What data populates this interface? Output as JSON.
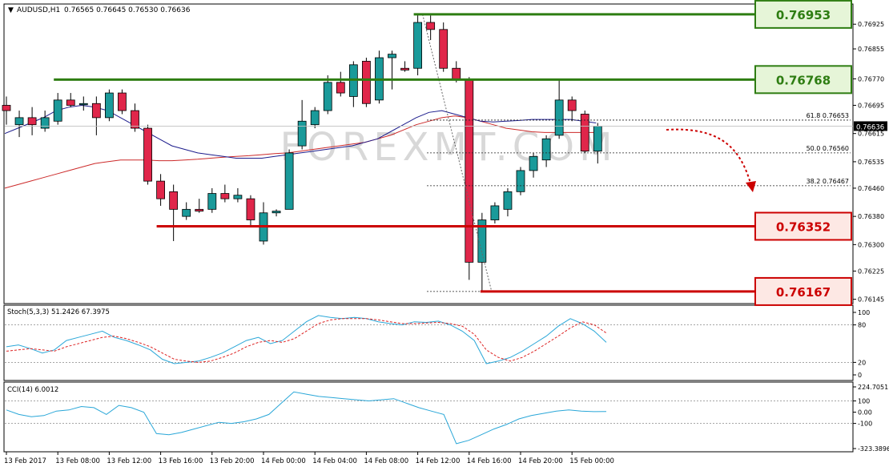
{
  "header": {
    "menu_arrow": "▼",
    "symbol": "AUDUSD,H1",
    "ohlc": "0.76565 0.76645 0.76530 0.76636"
  },
  "watermark": "FOREXMT.COM",
  "chart_data": [
    {
      "type": "candlestick",
      "panel": "price",
      "y_ticks": [
        "0.76925",
        "0.76855",
        "0.76770",
        "0.76695",
        "0.76615",
        "0.76535",
        "0.76460",
        "0.76380",
        "0.76300",
        "0.76225",
        "0.76145"
      ],
      "y_tick_values": [
        0.76925,
        0.76855,
        0.7677,
        0.76695,
        0.76615,
        0.76535,
        0.7646,
        0.7638,
        0.763,
        0.76225,
        0.76145
      ],
      "ylim": [
        0.76135,
        0.7698
      ],
      "current_price_label": "0.76636",
      "current_price": 0.76636,
      "colors": {
        "bull": "#1a9a9a",
        "bear": "#e0264a",
        "ma_blue": "#1c1c8c",
        "ma_red": "#cc2a2a",
        "level_green": "#2e7d12",
        "level_red": "#cc0000"
      },
      "candles": [
        {
          "o": 0.76695,
          "h": 0.7672,
          "l": 0.7664,
          "c": 0.7668
        },
        {
          "o": 0.7664,
          "h": 0.7668,
          "l": 0.76605,
          "c": 0.7666
        },
        {
          "o": 0.7666,
          "h": 0.7669,
          "l": 0.7661,
          "c": 0.7664
        },
        {
          "o": 0.7663,
          "h": 0.7668,
          "l": 0.7662,
          "c": 0.7666
        },
        {
          "o": 0.7665,
          "h": 0.7673,
          "l": 0.7664,
          "c": 0.7671
        },
        {
          "o": 0.7671,
          "h": 0.7673,
          "l": 0.7669,
          "c": 0.76695
        },
        {
          "o": 0.767,
          "h": 0.7672,
          "l": 0.7668,
          "c": 0.767
        },
        {
          "o": 0.767,
          "h": 0.7672,
          "l": 0.7661,
          "c": 0.7666
        },
        {
          "o": 0.7666,
          "h": 0.7674,
          "l": 0.7665,
          "c": 0.7673
        },
        {
          "o": 0.7673,
          "h": 0.7674,
          "l": 0.7667,
          "c": 0.7668
        },
        {
          "o": 0.7668,
          "h": 0.767,
          "l": 0.7662,
          "c": 0.7663
        },
        {
          "o": 0.7663,
          "h": 0.7664,
          "l": 0.7647,
          "c": 0.7648
        },
        {
          "o": 0.7648,
          "h": 0.765,
          "l": 0.7641,
          "c": 0.7643
        },
        {
          "o": 0.7645,
          "h": 0.7647,
          "l": 0.7631,
          "c": 0.764
        },
        {
          "o": 0.7638,
          "h": 0.7642,
          "l": 0.7637,
          "c": 0.764
        },
        {
          "o": 0.764,
          "h": 0.7643,
          "l": 0.7639,
          "c": 0.76395
        },
        {
          "o": 0.764,
          "h": 0.7646,
          "l": 0.7639,
          "c": 0.76445
        },
        {
          "o": 0.76445,
          "h": 0.7647,
          "l": 0.7642,
          "c": 0.7643
        },
        {
          "o": 0.7643,
          "h": 0.7646,
          "l": 0.7642,
          "c": 0.7644
        },
        {
          "o": 0.7643,
          "h": 0.7644,
          "l": 0.7635,
          "c": 0.7637
        },
        {
          "o": 0.7631,
          "h": 0.7642,
          "l": 0.763,
          "c": 0.7639
        },
        {
          "o": 0.7639,
          "h": 0.764,
          "l": 0.7638,
          "c": 0.76395
        },
        {
          "o": 0.764,
          "h": 0.7657,
          "l": 0.764,
          "c": 0.7656
        },
        {
          "o": 0.7658,
          "h": 0.7671,
          "l": 0.7657,
          "c": 0.7665
        },
        {
          "o": 0.7664,
          "h": 0.7669,
          "l": 0.7663,
          "c": 0.7668
        },
        {
          "o": 0.7668,
          "h": 0.7678,
          "l": 0.7667,
          "c": 0.7676
        },
        {
          "o": 0.7676,
          "h": 0.7679,
          "l": 0.7672,
          "c": 0.7673
        },
        {
          "o": 0.7672,
          "h": 0.7682,
          "l": 0.7669,
          "c": 0.7681
        },
        {
          "o": 0.7682,
          "h": 0.7683,
          "l": 0.7669,
          "c": 0.767
        },
        {
          "o": 0.7671,
          "h": 0.7685,
          "l": 0.767,
          "c": 0.7683
        },
        {
          "o": 0.7683,
          "h": 0.7685,
          "l": 0.7674,
          "c": 0.7684
        },
        {
          "o": 0.768,
          "h": 0.7682,
          "l": 0.7679,
          "c": 0.76795
        },
        {
          "o": 0.768,
          "h": 0.76953,
          "l": 0.7678,
          "c": 0.7693
        },
        {
          "o": 0.7693,
          "h": 0.7695,
          "l": 0.7688,
          "c": 0.7691
        },
        {
          "o": 0.7691,
          "h": 0.7693,
          "l": 0.7679,
          "c": 0.768
        },
        {
          "o": 0.768,
          "h": 0.7682,
          "l": 0.7676,
          "c": 0.7677
        },
        {
          "o": 0.7677,
          "h": 0.76775,
          "l": 0.762,
          "c": 0.7625
        },
        {
          "o": 0.7625,
          "h": 0.7639,
          "l": 0.76167,
          "c": 0.7637
        },
        {
          "o": 0.7637,
          "h": 0.7642,
          "l": 0.7636,
          "c": 0.7641
        },
        {
          "o": 0.764,
          "h": 0.7646,
          "l": 0.7638,
          "c": 0.7645
        },
        {
          "o": 0.7645,
          "h": 0.7652,
          "l": 0.7644,
          "c": 0.7651
        },
        {
          "o": 0.7651,
          "h": 0.7656,
          "l": 0.7649,
          "c": 0.7655
        },
        {
          "o": 0.7654,
          "h": 0.7661,
          "l": 0.7652,
          "c": 0.766
        },
        {
          "o": 0.7661,
          "h": 0.76768,
          "l": 0.766,
          "c": 0.7671
        },
        {
          "o": 0.7671,
          "h": 0.7672,
          "l": 0.7665,
          "c": 0.7668
        },
        {
          "o": 0.7667,
          "h": 0.7668,
          "l": 0.7656,
          "c": 0.76565
        },
        {
          "o": 0.76565,
          "h": 0.76645,
          "l": 0.7653,
          "c": 0.76636
        }
      ],
      "ma_blue": [
        0.76615,
        0.7663,
        0.76645,
        0.7666,
        0.7668,
        0.7669,
        0.76695,
        0.7669,
        0.7668,
        0.7666,
        0.7664,
        0.7662,
        0.766,
        0.7658,
        0.7657,
        0.7656,
        0.76555,
        0.7655,
        0.76545,
        0.76545,
        0.76545,
        0.7655,
        0.76555,
        0.7656,
        0.76565,
        0.7657,
        0.76575,
        0.7658,
        0.7659,
        0.766,
        0.7662,
        0.7664,
        0.7666,
        0.76675,
        0.7668,
        0.7667,
        0.7666,
        0.7665,
        0.76648,
        0.7665,
        0.76652,
        0.76655,
        0.76655,
        0.76655,
        0.76655,
        0.7665,
        0.76645
      ],
      "ma_red": [
        0.7646,
        0.7647,
        0.7648,
        0.7649,
        0.765,
        0.7651,
        0.7652,
        0.7653,
        0.76535,
        0.7654,
        0.7654,
        0.7654,
        0.76538,
        0.76538,
        0.7654,
        0.76542,
        0.76545,
        0.76548,
        0.7655,
        0.76552,
        0.76555,
        0.76558,
        0.7656,
        0.76565,
        0.7657,
        0.76575,
        0.7658,
        0.76585,
        0.7659,
        0.766,
        0.7661,
        0.76625,
        0.7664,
        0.7665,
        0.7666,
        0.76665,
        0.7666,
        0.7665,
        0.7664,
        0.7663,
        0.76625,
        0.7662,
        0.76618,
        0.76618,
        0.76618,
        0.76618,
        0.76618
      ],
      "levels": [
        {
          "label": "0.76953",
          "value": 0.76953,
          "kind": "resistance",
          "start_index": 32
        },
        {
          "label": "0.76768",
          "value": 0.76768,
          "kind": "resistance",
          "start_index": 4
        },
        {
          "label": "0.76352",
          "value": 0.76352,
          "kind": "support",
          "start_index": 12
        },
        {
          "label": "0.76167",
          "value": 0.76167,
          "kind": "support",
          "start_index": 37
        }
      ],
      "fibonacci": [
        {
          "label": "61.8 0.76653",
          "value": 0.76653
        },
        {
          "label": "50.0 0.76560",
          "value": 0.7656
        },
        {
          "label": "38.2 0.76467",
          "value": 0.76467
        }
      ],
      "fib_anchor": {
        "from_index": 32,
        "from_value": 0.76953,
        "to_index": 37,
        "to_value": 0.76167
      }
    },
    {
      "type": "line",
      "panel": "stochastic",
      "label": "Stoch(5,3,3) 51.2426 67.3975",
      "y_ticks": [
        "100",
        "80",
        "20",
        "0"
      ],
      "y_tick_values": [
        100,
        80,
        20,
        0
      ],
      "ylim": [
        0,
        100
      ],
      "series": [
        {
          "color": "#2aa7d8",
          "dash": false,
          "values": [
            45,
            48,
            42,
            35,
            40,
            55,
            60,
            65,
            70,
            60,
            55,
            48,
            40,
            25,
            18,
            20,
            22,
            28,
            35,
            45,
            55,
            60,
            50,
            55,
            70,
            85,
            95,
            92,
            90,
            92,
            90,
            85,
            82,
            80,
            85,
            84,
            86,
            80,
            70,
            55,
            18,
            22,
            28,
            38,
            50,
            62,
            78,
            90,
            82,
            70,
            52
          ]
        },
        {
          "color": "#dd2222",
          "dash": true,
          "values": [
            38,
            40,
            42,
            40,
            38,
            45,
            50,
            55,
            60,
            62,
            58,
            52,
            45,
            35,
            25,
            22,
            20,
            22,
            28,
            35,
            45,
            52,
            55,
            52,
            58,
            70,
            82,
            88,
            90,
            90,
            90,
            88,
            85,
            82,
            82,
            83,
            84,
            82,
            78,
            65,
            40,
            28,
            22,
            28,
            38,
            50,
            62,
            75,
            85,
            80,
            67
          ]
        }
      ]
    },
    {
      "type": "line",
      "panel": "cci",
      "label": "CCI(14) 6.0012",
      "y_ticks": [
        "224.7051",
        "100",
        "0.00",
        "-100",
        "-323.3896"
      ],
      "y_tick_values": [
        224.7051,
        100,
        0,
        -100,
        -323.3896
      ],
      "ylim": [
        -323.3896,
        224.7051
      ],
      "series": [
        {
          "color": "#2aa7d8",
          "dash": false,
          "values": [
            20,
            -20,
            -40,
            -30,
            10,
            20,
            50,
            40,
            -20,
            60,
            40,
            0,
            -190,
            -200,
            -180,
            -150,
            -120,
            -90,
            -100,
            -85,
            -60,
            -20,
            80,
            180,
            160,
            140,
            130,
            120,
            110,
            100,
            110,
            120,
            80,
            40,
            10,
            -20,
            -280,
            -250,
            -200,
            -150,
            -110,
            -60,
            -30,
            -10,
            10,
            20,
            10,
            5,
            6
          ]
        }
      ]
    }
  ],
  "x_axis": {
    "labels": [
      "13 Feb 2017",
      "13 Feb 08:00",
      "13 Feb 12:00",
      "13 Feb 16:00",
      "13 Feb 20:00",
      "14 Feb 00:00",
      "14 Feb 04:00",
      "14 Feb 08:00",
      "14 Feb 12:00",
      "14 Feb 16:00",
      "14 Feb 20:00",
      "15 Feb 00:00"
    ],
    "label_candle_index": [
      0,
      4,
      8,
      12,
      16,
      20,
      24,
      28,
      32,
      36,
      40,
      44
    ]
  }
}
